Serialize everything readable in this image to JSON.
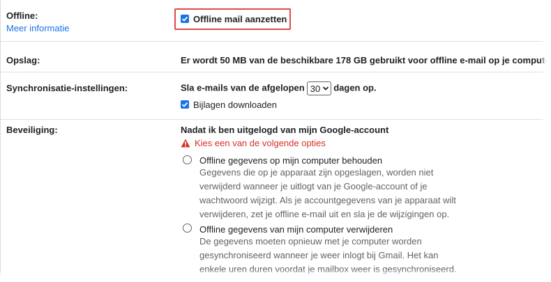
{
  "offline": {
    "label": "Offline:",
    "link": "Meer informatie",
    "checkbox_label": "Offline mail aanzetten"
  },
  "storage": {
    "label": "Opslag:",
    "text": "Er wordt 50 MB van de beschikbare 178 GB gebruikt voor offline e-mail op je compute"
  },
  "sync": {
    "label": "Synchronisatie-instellingen:",
    "text_before": "Sla e-mails van de afgelopen",
    "days_value": "30",
    "text_after": "dagen op.",
    "attachments_label": "Bijlagen downloaden"
  },
  "security": {
    "label": "Beveiliging:",
    "heading": "Nadat ik ben uitgelogd van mijn Google-account",
    "warning": "Kies een van de volgende opties",
    "option1_title": "Offline gegevens op mijn computer behouden",
    "option1_line1": "Gegevens die op je apparaat zijn opgeslagen, worden niet",
    "option1_line2": "verwijderd wanneer je uitlogt van je Google-account of je",
    "option1_line3": "wachtwoord wijzigt. Als je accountgegevens van je apparaat wilt",
    "option1_line4": "verwijderen, zet je offline e-mail uit en sla je de wijzigingen op.",
    "option2_title": "Offline gegevens van mijn computer verwijderen",
    "option2_line1": "De gegevens moeten opnieuw met je computer worden",
    "option2_line2": "gesynchroniseerd wanneer je weer inlogt bij Gmail. Het kan",
    "option2_line3": "enkele uren duren voordat je mailbox weer is gesynchroniseerd."
  },
  "colors": {
    "accent": "#1a73e8",
    "warning": "#d93025",
    "highlight": "#e04848"
  }
}
